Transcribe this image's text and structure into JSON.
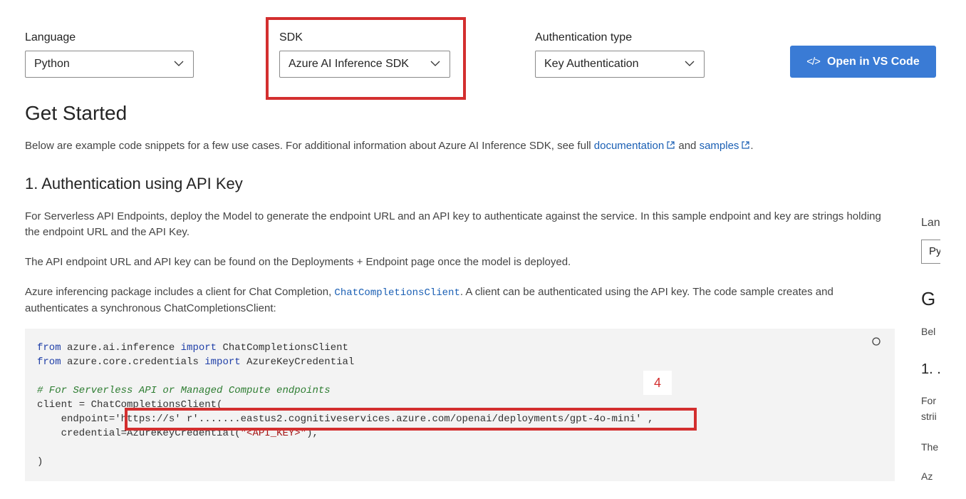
{
  "controls": {
    "language": {
      "label": "Language",
      "value": "Python"
    },
    "sdk": {
      "label": "SDK",
      "value": "Azure AI Inference SDK"
    },
    "auth": {
      "label": "Authentication type",
      "value": "Key Authentication"
    },
    "vs_button": {
      "icon": "</>",
      "label": "Open in VS Code"
    }
  },
  "main": {
    "title": "Get Started",
    "intro_prefix": "Below are example code snippets for a few use cases. For additional information about Azure AI Inference SDK, see full",
    "intro_link1": "documentation",
    "intro_and": "and",
    "intro_link2": "samples",
    "intro_suffix": ".",
    "section_title": "1. Authentication using API Key",
    "para1": "For Serverless API Endpoints, deploy the Model to generate the endpoint URL and an API key to authenticate against the service. In this sample endpoint and key are strings holding the endpoint URL and the API Key.",
    "para2": "The API endpoint URL and API key can be found on the Deployments + Endpoint page once the model is deployed.",
    "para3_prefix": "Azure inferencing package includes a client for Chat Completion,",
    "para3_code": "ChatCompletionsClient",
    "para3_suffix": ". A client can be authenticated using the API key. The code sample creates and authenticates a synchronous ChatCompletionsClient:"
  },
  "code": {
    "l1_kw1": "from",
    "l1_mod": " azure.ai.inference ",
    "l1_kw2": "import",
    "l1_name": " ChatCompletionsClient",
    "l2_kw1": "from",
    "l2_mod": " azure.core.credentials ",
    "l2_kw2": "import",
    "l2_name": " AzureKeyCredential",
    "comment": "# For Serverless API or Managed Compute endpoints",
    "l5": "client = ChatCompletionsClient(",
    "l6_prefix": "    endpoint=",
    "l6_url": "'https://s' r'.......eastus2.cognitiveservices.azure.com/openai/deployments/gpt-4o-mini'",
    "l6_suffix": ",",
    "l7_prefix": "    credential=AzureKeyCredential(",
    "l7_str": "\"<API_KEY>\"",
    "l7_suffix": "),",
    "l9": ")"
  },
  "annotation": {
    "number": "4"
  },
  "right_panel": {
    "lang_label": "Lan",
    "lang_value": "Py",
    "heading": "G",
    "intro": "Bel",
    "section": "1. .",
    "para1": "For",
    "para1b": "strii",
    "para2": "The",
    "para3": "Az"
  },
  "colors": {
    "accent": "#3a7bd5",
    "highlight": "#d32f2f",
    "link": "#1a5fb4"
  }
}
